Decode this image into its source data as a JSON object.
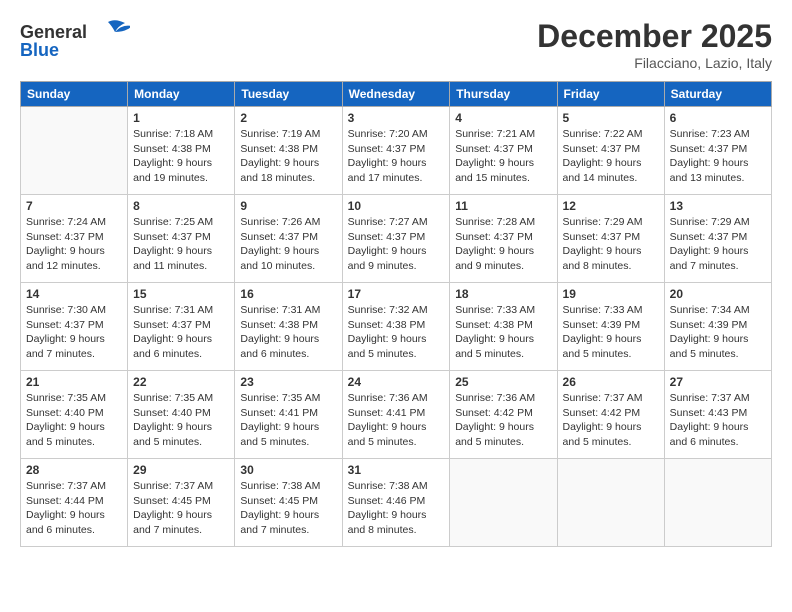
{
  "header": {
    "logo_line1": "General",
    "logo_line2": "Blue",
    "month_title": "December 2025",
    "location": "Filacciano, Lazio, Italy"
  },
  "weekdays": [
    "Sunday",
    "Monday",
    "Tuesday",
    "Wednesday",
    "Thursday",
    "Friday",
    "Saturday"
  ],
  "weeks": [
    [
      {
        "day": "",
        "sunrise": "",
        "sunset": "",
        "daylight": ""
      },
      {
        "day": "1",
        "sunrise": "Sunrise: 7:18 AM",
        "sunset": "Sunset: 4:38 PM",
        "daylight": "Daylight: 9 hours and 19 minutes."
      },
      {
        "day": "2",
        "sunrise": "Sunrise: 7:19 AM",
        "sunset": "Sunset: 4:38 PM",
        "daylight": "Daylight: 9 hours and 18 minutes."
      },
      {
        "day": "3",
        "sunrise": "Sunrise: 7:20 AM",
        "sunset": "Sunset: 4:37 PM",
        "daylight": "Daylight: 9 hours and 17 minutes."
      },
      {
        "day": "4",
        "sunrise": "Sunrise: 7:21 AM",
        "sunset": "Sunset: 4:37 PM",
        "daylight": "Daylight: 9 hours and 15 minutes."
      },
      {
        "day": "5",
        "sunrise": "Sunrise: 7:22 AM",
        "sunset": "Sunset: 4:37 PM",
        "daylight": "Daylight: 9 hours and 14 minutes."
      },
      {
        "day": "6",
        "sunrise": "Sunrise: 7:23 AM",
        "sunset": "Sunset: 4:37 PM",
        "daylight": "Daylight: 9 hours and 13 minutes."
      }
    ],
    [
      {
        "day": "7",
        "sunrise": "Sunrise: 7:24 AM",
        "sunset": "Sunset: 4:37 PM",
        "daylight": "Daylight: 9 hours and 12 minutes."
      },
      {
        "day": "8",
        "sunrise": "Sunrise: 7:25 AM",
        "sunset": "Sunset: 4:37 PM",
        "daylight": "Daylight: 9 hours and 11 minutes."
      },
      {
        "day": "9",
        "sunrise": "Sunrise: 7:26 AM",
        "sunset": "Sunset: 4:37 PM",
        "daylight": "Daylight: 9 hours and 10 minutes."
      },
      {
        "day": "10",
        "sunrise": "Sunrise: 7:27 AM",
        "sunset": "Sunset: 4:37 PM",
        "daylight": "Daylight: 9 hours and 9 minutes."
      },
      {
        "day": "11",
        "sunrise": "Sunrise: 7:28 AM",
        "sunset": "Sunset: 4:37 PM",
        "daylight": "Daylight: 9 hours and 9 minutes."
      },
      {
        "day": "12",
        "sunrise": "Sunrise: 7:29 AM",
        "sunset": "Sunset: 4:37 PM",
        "daylight": "Daylight: 9 hours and 8 minutes."
      },
      {
        "day": "13",
        "sunrise": "Sunrise: 7:29 AM",
        "sunset": "Sunset: 4:37 PM",
        "daylight": "Daylight: 9 hours and 7 minutes."
      }
    ],
    [
      {
        "day": "14",
        "sunrise": "Sunrise: 7:30 AM",
        "sunset": "Sunset: 4:37 PM",
        "daylight": "Daylight: 9 hours and 7 minutes."
      },
      {
        "day": "15",
        "sunrise": "Sunrise: 7:31 AM",
        "sunset": "Sunset: 4:37 PM",
        "daylight": "Daylight: 9 hours and 6 minutes."
      },
      {
        "day": "16",
        "sunrise": "Sunrise: 7:31 AM",
        "sunset": "Sunset: 4:38 PM",
        "daylight": "Daylight: 9 hours and 6 minutes."
      },
      {
        "day": "17",
        "sunrise": "Sunrise: 7:32 AM",
        "sunset": "Sunset: 4:38 PM",
        "daylight": "Daylight: 9 hours and 5 minutes."
      },
      {
        "day": "18",
        "sunrise": "Sunrise: 7:33 AM",
        "sunset": "Sunset: 4:38 PM",
        "daylight": "Daylight: 9 hours and 5 minutes."
      },
      {
        "day": "19",
        "sunrise": "Sunrise: 7:33 AM",
        "sunset": "Sunset: 4:39 PM",
        "daylight": "Daylight: 9 hours and 5 minutes."
      },
      {
        "day": "20",
        "sunrise": "Sunrise: 7:34 AM",
        "sunset": "Sunset: 4:39 PM",
        "daylight": "Daylight: 9 hours and 5 minutes."
      }
    ],
    [
      {
        "day": "21",
        "sunrise": "Sunrise: 7:35 AM",
        "sunset": "Sunset: 4:40 PM",
        "daylight": "Daylight: 9 hours and 5 minutes."
      },
      {
        "day": "22",
        "sunrise": "Sunrise: 7:35 AM",
        "sunset": "Sunset: 4:40 PM",
        "daylight": "Daylight: 9 hours and 5 minutes."
      },
      {
        "day": "23",
        "sunrise": "Sunrise: 7:35 AM",
        "sunset": "Sunset: 4:41 PM",
        "daylight": "Daylight: 9 hours and 5 minutes."
      },
      {
        "day": "24",
        "sunrise": "Sunrise: 7:36 AM",
        "sunset": "Sunset: 4:41 PM",
        "daylight": "Daylight: 9 hours and 5 minutes."
      },
      {
        "day": "25",
        "sunrise": "Sunrise: 7:36 AM",
        "sunset": "Sunset: 4:42 PM",
        "daylight": "Daylight: 9 hours and 5 minutes."
      },
      {
        "day": "26",
        "sunrise": "Sunrise: 7:37 AM",
        "sunset": "Sunset: 4:42 PM",
        "daylight": "Daylight: 9 hours and 5 minutes."
      },
      {
        "day": "27",
        "sunrise": "Sunrise: 7:37 AM",
        "sunset": "Sunset: 4:43 PM",
        "daylight": "Daylight: 9 hours and 6 minutes."
      }
    ],
    [
      {
        "day": "28",
        "sunrise": "Sunrise: 7:37 AM",
        "sunset": "Sunset: 4:44 PM",
        "daylight": "Daylight: 9 hours and 6 minutes."
      },
      {
        "day": "29",
        "sunrise": "Sunrise: 7:37 AM",
        "sunset": "Sunset: 4:45 PM",
        "daylight": "Daylight: 9 hours and 7 minutes."
      },
      {
        "day": "30",
        "sunrise": "Sunrise: 7:38 AM",
        "sunset": "Sunset: 4:45 PM",
        "daylight": "Daylight: 9 hours and 7 minutes."
      },
      {
        "day": "31",
        "sunrise": "Sunrise: 7:38 AM",
        "sunset": "Sunset: 4:46 PM",
        "daylight": "Daylight: 9 hours and 8 minutes."
      },
      {
        "day": "",
        "sunrise": "",
        "sunset": "",
        "daylight": ""
      },
      {
        "day": "",
        "sunrise": "",
        "sunset": "",
        "daylight": ""
      },
      {
        "day": "",
        "sunrise": "",
        "sunset": "",
        "daylight": ""
      }
    ]
  ]
}
